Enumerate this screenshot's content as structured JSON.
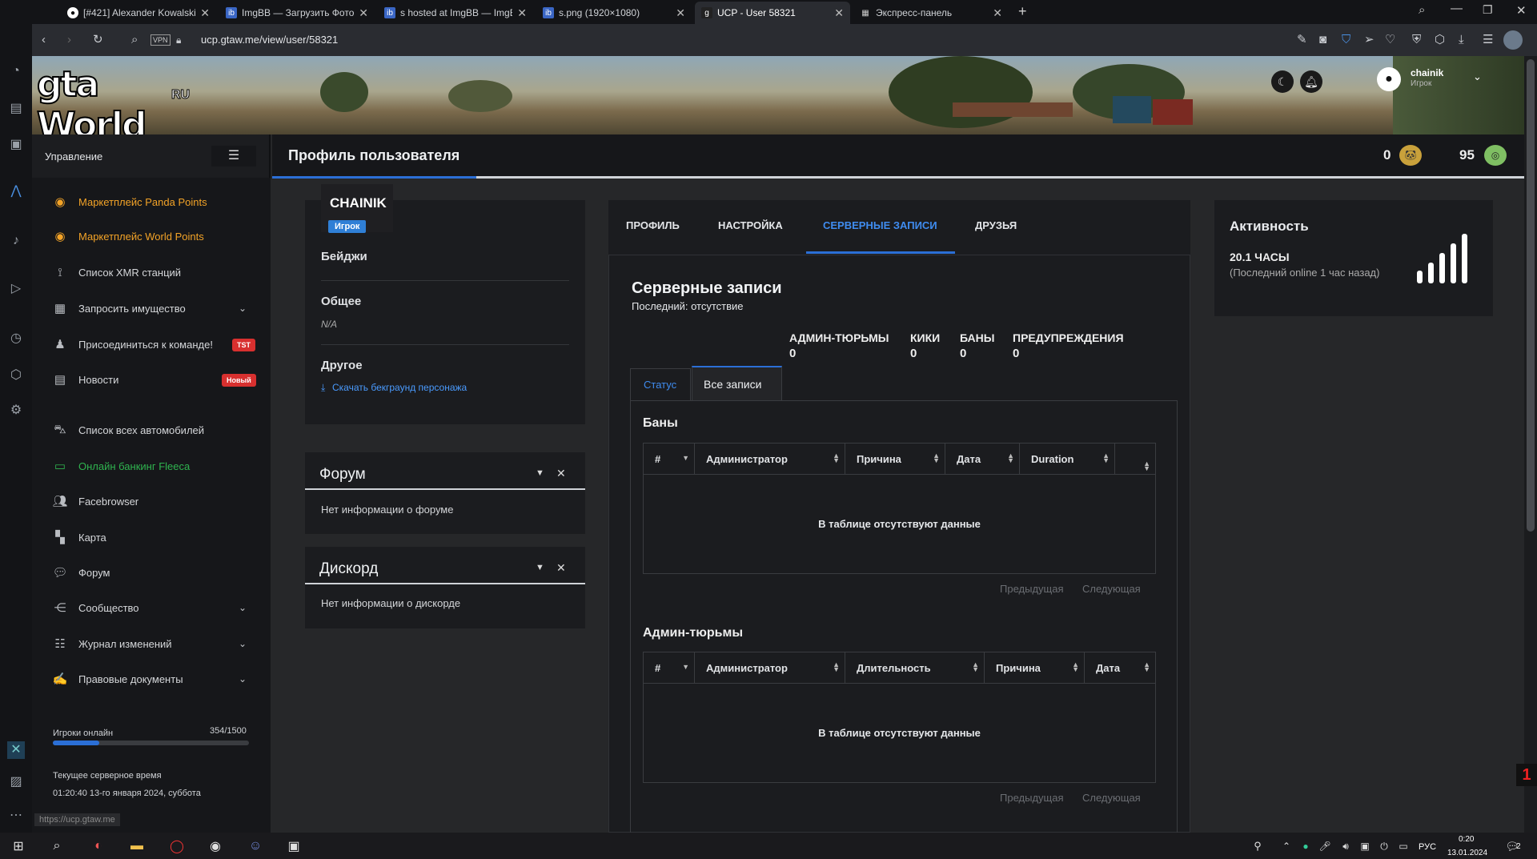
{
  "browser": {
    "tabs": [
      {
        "label": "[#421] Alexander Kowalski"
      },
      {
        "label": "ImgBB — Загрузить Фото"
      },
      {
        "label": "s hosted at ImgBB — ImgB"
      },
      {
        "label": "s.png (1920×1080)"
      },
      {
        "label": "UCP - User 58321"
      },
      {
        "label": "Экспресс-панель"
      }
    ],
    "vpn": "VPN",
    "url": "ucp.gtaw.me/view/user/58321"
  },
  "header": {
    "logo_text": "gta World",
    "logo_sub": "RU",
    "username": "chainik",
    "role": "Игрок"
  },
  "sidebar": {
    "title": "Управление",
    "items": [
      {
        "label": "Маркетплейс Panda Points",
        "icon": "coins-icon"
      },
      {
        "label": "Маркетплейс World Points",
        "icon": "coins-icon"
      },
      {
        "label": "Список XMR станций",
        "icon": "antenna-icon"
      },
      {
        "label": "Запросить имущество",
        "icon": "building-icon"
      },
      {
        "label": "Присоединиться к команде!",
        "icon": "user-tie-icon",
        "badge": "TST"
      },
      {
        "label": "Новости",
        "icon": "newspaper-icon",
        "badge": "Новый"
      },
      {
        "label": "Список всех автомобилей",
        "icon": "car-icon"
      },
      {
        "label": "Онлайн банкинг Fleeca",
        "icon": "money-icon"
      },
      {
        "label": "Facebrowser",
        "icon": "users-icon"
      },
      {
        "label": "Карта",
        "icon": "map-icon"
      },
      {
        "label": "Форум",
        "icon": "comments-icon"
      },
      {
        "label": "Сообщество",
        "icon": "share-icon"
      },
      {
        "label": "Журнал изменений",
        "icon": "list-icon"
      },
      {
        "label": "Правовые документы",
        "icon": "file-sign-icon"
      }
    ],
    "players_label": "Игроки онлайн",
    "players_value": "354/1500",
    "players_fraction": 0.236,
    "server_time_label": "Текущее серверное время",
    "server_time_value": "01:20:40 13-го января 2024, суббота",
    "status_url": "https://ucp.gtaw.me"
  },
  "topbar": {
    "title": "Профиль пользователя",
    "panda_points": "0",
    "world_points": "95"
  },
  "profile": {
    "name": "CHAINIK",
    "role_badge": "Игрок",
    "badges_label": "Бейджи",
    "general_label": "Общее",
    "general_value": "N/A",
    "other_label": "Другое",
    "download_link": "Скачать бекграунд персонажа"
  },
  "forum_card": {
    "title": "Форум",
    "body": "Нет информации о форуме"
  },
  "discord_card": {
    "title": "Дискорд",
    "body": "Нет информации о дискорде"
  },
  "tabs": [
    "ПРОФИЛЬ",
    "НАСТРОЙКА",
    "СЕРВЕРНЫЕ ЗАПИСИ",
    "ДРУЗЬЯ"
  ],
  "records": {
    "title": "Серверные записи",
    "last": "Последний: отсутствие",
    "stats": [
      {
        "label": "АДМИН-ТЮРЬМЫ",
        "value": "0"
      },
      {
        "label": "КИКИ",
        "value": "0"
      },
      {
        "label": "БАНЫ",
        "value": "0"
      },
      {
        "label": "ПРЕДУПРЕЖДЕНИЯ",
        "value": "0"
      }
    ],
    "subtabs": [
      "Статус",
      "Все записи"
    ],
    "bans": {
      "title": "Баны",
      "columns": [
        "#",
        "Администратор",
        "Причина",
        "Дата",
        "Duration",
        ""
      ],
      "empty": "В таблице отсутствуют данные"
    },
    "jails": {
      "title": "Админ-тюрьмы",
      "columns": [
        "#",
        "Администратор",
        "Длительность",
        "Причина",
        "Дата"
      ],
      "empty": "В таблице отсутствуют данные"
    },
    "prev": "Предыдущая",
    "next": "Следующая"
  },
  "activity": {
    "title": "Активность",
    "hours": "20.1 ЧАСЫ",
    "last_online": "(Последний online 1 час назад)"
  },
  "taskbar": {
    "lang": "РУС",
    "time": "0:20",
    "date": "13.01.2024",
    "notif": "2"
  }
}
